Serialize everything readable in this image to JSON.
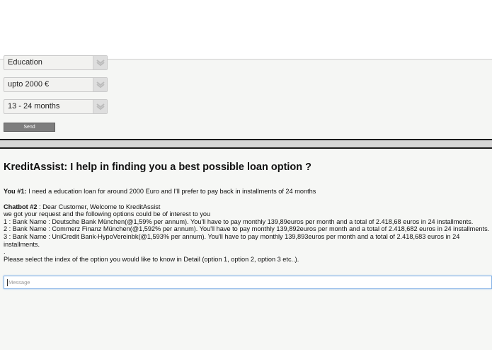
{
  "form": {
    "loan_purpose": "Education",
    "loan_amount": "upto 2000 €",
    "loan_duration": "13 - 24 months",
    "send_label": "Send"
  },
  "chat": {
    "title": "KreditAssist: I help in finding you a best possible loan option ?",
    "user_msg": {
      "speaker": "You #1:",
      "text": " I need a education loan for around 2000 Euro and I'll prefer to pay back in installments of 24 months"
    },
    "bot_msg": {
      "speaker": "Chatbot #2",
      "greeting": " : Dear Customer, Welcome to KreditAssist",
      "intro": "we got your request and the following options could be of interest to you",
      "options": [
        "1 : Bank Name : Deutsche Bank München(@1,59% per annum). You'll have to pay monthly 139,89euros per month and a total of 2.418,68 euros in 24 installments.",
        "2 : Bank Name : Commerz Finanz München(@1,592% per annum). You'll have to pay monthly 139,892euros per month and a total of 2.418,682 euros in 24 installments.",
        "3 : Bank Name : UniCredit Bank-HypoVereinbk(@1,593% per annum). You'll have to pay monthly 139,893euros per month and a total of 2.418,683 euros in 24 installments."
      ],
      "dot": ".",
      "prompt": "Please select the index of the option you would like to know in Detail (option 1, option 2, option 3 etc..)."
    },
    "input_placeholder": "Message"
  }
}
